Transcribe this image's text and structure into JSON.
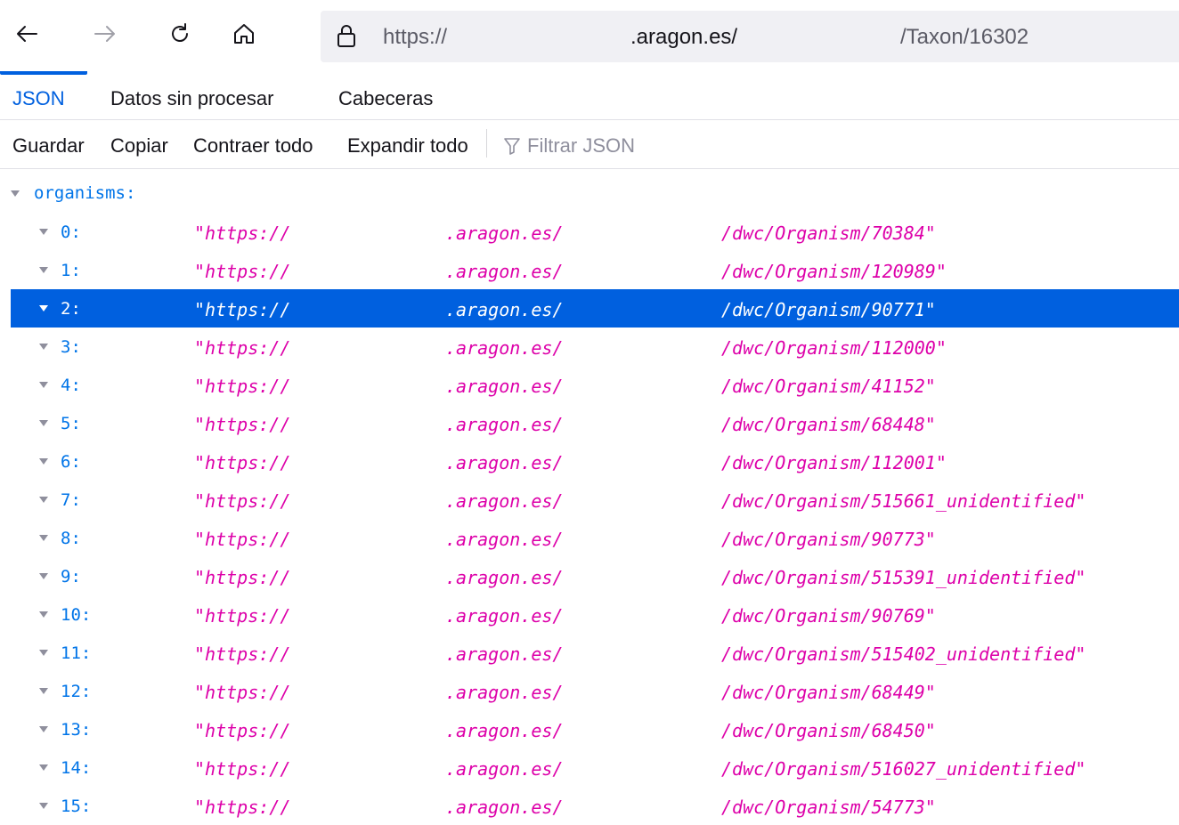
{
  "url": {
    "scheme": "https://",
    "host": ".aragon.es/",
    "path": "/Taxon/16302"
  },
  "tabs": [
    {
      "label": "JSON",
      "active": true
    },
    {
      "label": "Datos sin procesar",
      "active": false
    },
    {
      "label": "Cabeceras",
      "active": false
    }
  ],
  "toolbar": {
    "save": "Guardar",
    "copy": "Copiar",
    "collapse_all": "Contraer todo",
    "expand_all": "Expandir todo",
    "filter_placeholder": "Filtrar JSON"
  },
  "tree": {
    "root_key": "organisms:",
    "selected_index": 2,
    "rows": [
      {
        "key": "0:",
        "p1": "\"https://",
        "p2": ".aragon.es/",
        "p3": "/dwc/Organism/70384\""
      },
      {
        "key": "1:",
        "p1": "\"https://",
        "p2": ".aragon.es/",
        "p3": "/dwc/Organism/120989\""
      },
      {
        "key": "2:",
        "p1": "\"https://",
        "p2": ".aragon.es/",
        "p3": "/dwc/Organism/90771\""
      },
      {
        "key": "3:",
        "p1": "\"https://",
        "p2": ".aragon.es/",
        "p3": "/dwc/Organism/112000\""
      },
      {
        "key": "4:",
        "p1": "\"https://",
        "p2": ".aragon.es/",
        "p3": "/dwc/Organism/41152\""
      },
      {
        "key": "5:",
        "p1": "\"https://",
        "p2": ".aragon.es/",
        "p3": "/dwc/Organism/68448\""
      },
      {
        "key": "6:",
        "p1": "\"https://",
        "p2": ".aragon.es/",
        "p3": "/dwc/Organism/112001\""
      },
      {
        "key": "7:",
        "p1": "\"https://",
        "p2": ".aragon.es/",
        "p3": "/dwc/Organism/515661_unidentified\""
      },
      {
        "key": "8:",
        "p1": "\"https://",
        "p2": ".aragon.es/",
        "p3": "/dwc/Organism/90773\""
      },
      {
        "key": "9:",
        "p1": "\"https://",
        "p2": ".aragon.es/",
        "p3": "/dwc/Organism/515391_unidentified\""
      },
      {
        "key": "10:",
        "p1": "\"https://",
        "p2": ".aragon.es/",
        "p3": "/dwc/Organism/90769\""
      },
      {
        "key": "11:",
        "p1": "\"https://",
        "p2": ".aragon.es/",
        "p3": "/dwc/Organism/515402_unidentified\""
      },
      {
        "key": "12:",
        "p1": "\"https://",
        "p2": ".aragon.es/",
        "p3": "/dwc/Organism/68449\""
      },
      {
        "key": "13:",
        "p1": "\"https://",
        "p2": ".aragon.es/",
        "p3": "/dwc/Organism/68450\""
      },
      {
        "key": "14:",
        "p1": "\"https://",
        "p2": ".aragon.es/",
        "p3": "/dwc/Organism/516027_unidentified\""
      },
      {
        "key": "15:",
        "p1": "\"https://",
        "p2": ".aragon.es/",
        "p3": "/dwc/Organism/54773\""
      }
    ]
  },
  "colors": {
    "accent": "#0060df",
    "json_key": "#0074e8",
    "json_string": "#dd00a9"
  }
}
